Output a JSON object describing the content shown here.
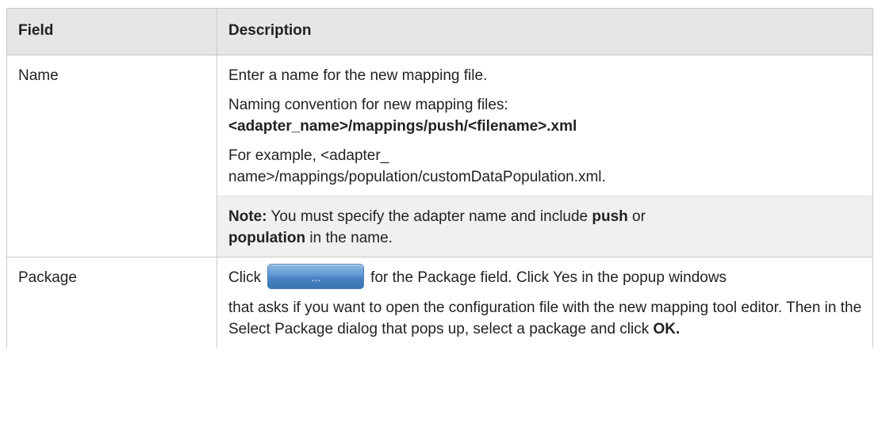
{
  "table": {
    "headers": {
      "field": "Field",
      "description": "Description"
    },
    "rows": [
      {
        "field": "Name",
        "desc": {
          "p1": "Enter a name for the new mapping file.",
          "p2_line1": "Naming convention for new mapping files:",
          "p2_line2": "<adapter_name>/mappings/push/<filename>.xml",
          "p3_line1": "For example, <adapter_",
          "p3_line2": "name>/mappings/population/customDataPopulation.xml.",
          "note": {
            "label": "Note:",
            "text1": " You must specify the adapter name and include ",
            "bold1": "push",
            "text2": " or",
            "bold2": "population",
            "text3": " in the name."
          }
        }
      },
      {
        "field": "Package",
        "desc": {
          "click": "Click",
          "button_label": "...",
          "after_button": "for the Package field. Click Yes in the popup windows",
          "p2": "that asks if you want to open the configuration file with the new mapping tool editor. Then in the Select Package dialog that pops up, select a package and click ",
          "ok": "OK."
        }
      }
    ]
  }
}
